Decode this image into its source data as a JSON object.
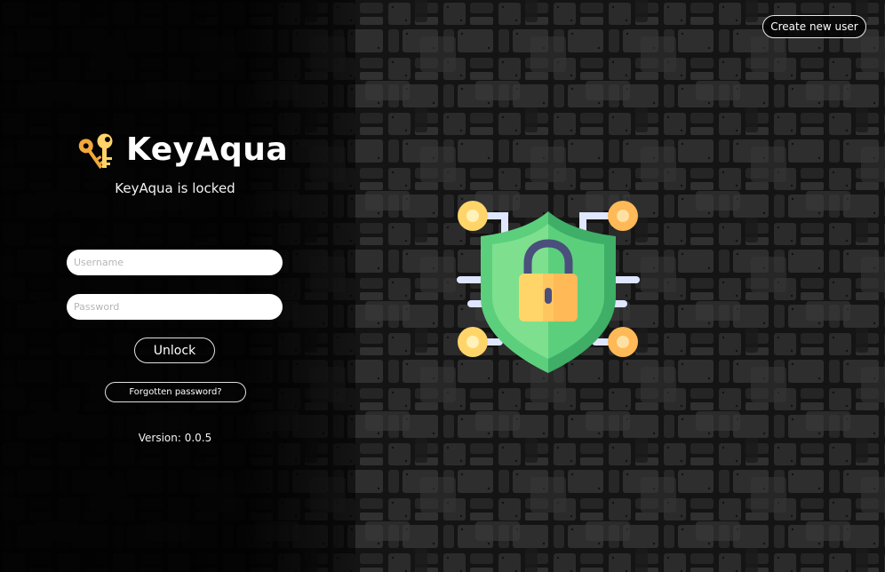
{
  "header": {
    "create_user_label": "Create new user"
  },
  "brand": {
    "title": "KeyAqua",
    "icon": "keys-icon",
    "subtitle": "KeyAqua is locked"
  },
  "login": {
    "username_placeholder": "Username",
    "username_value": "",
    "password_placeholder": "Password",
    "password_value": "",
    "unlock_label": "Unlock",
    "forgot_label": "Forgotten password?"
  },
  "footer": {
    "version": "Version: 0.0.5"
  },
  "illustration": {
    "icon": "security-shield-lock-icon"
  },
  "colors": {
    "background": "#0b0b0b",
    "shield_green": "#5ccf7d",
    "shield_dark_green": "#3fae67",
    "lock_yellow": "#ffd56a",
    "lock_orange": "#ffb957",
    "circuit_node": "#ffd56a",
    "circuit_line": "#dfe6ff",
    "key_gold": "#f7b733"
  }
}
